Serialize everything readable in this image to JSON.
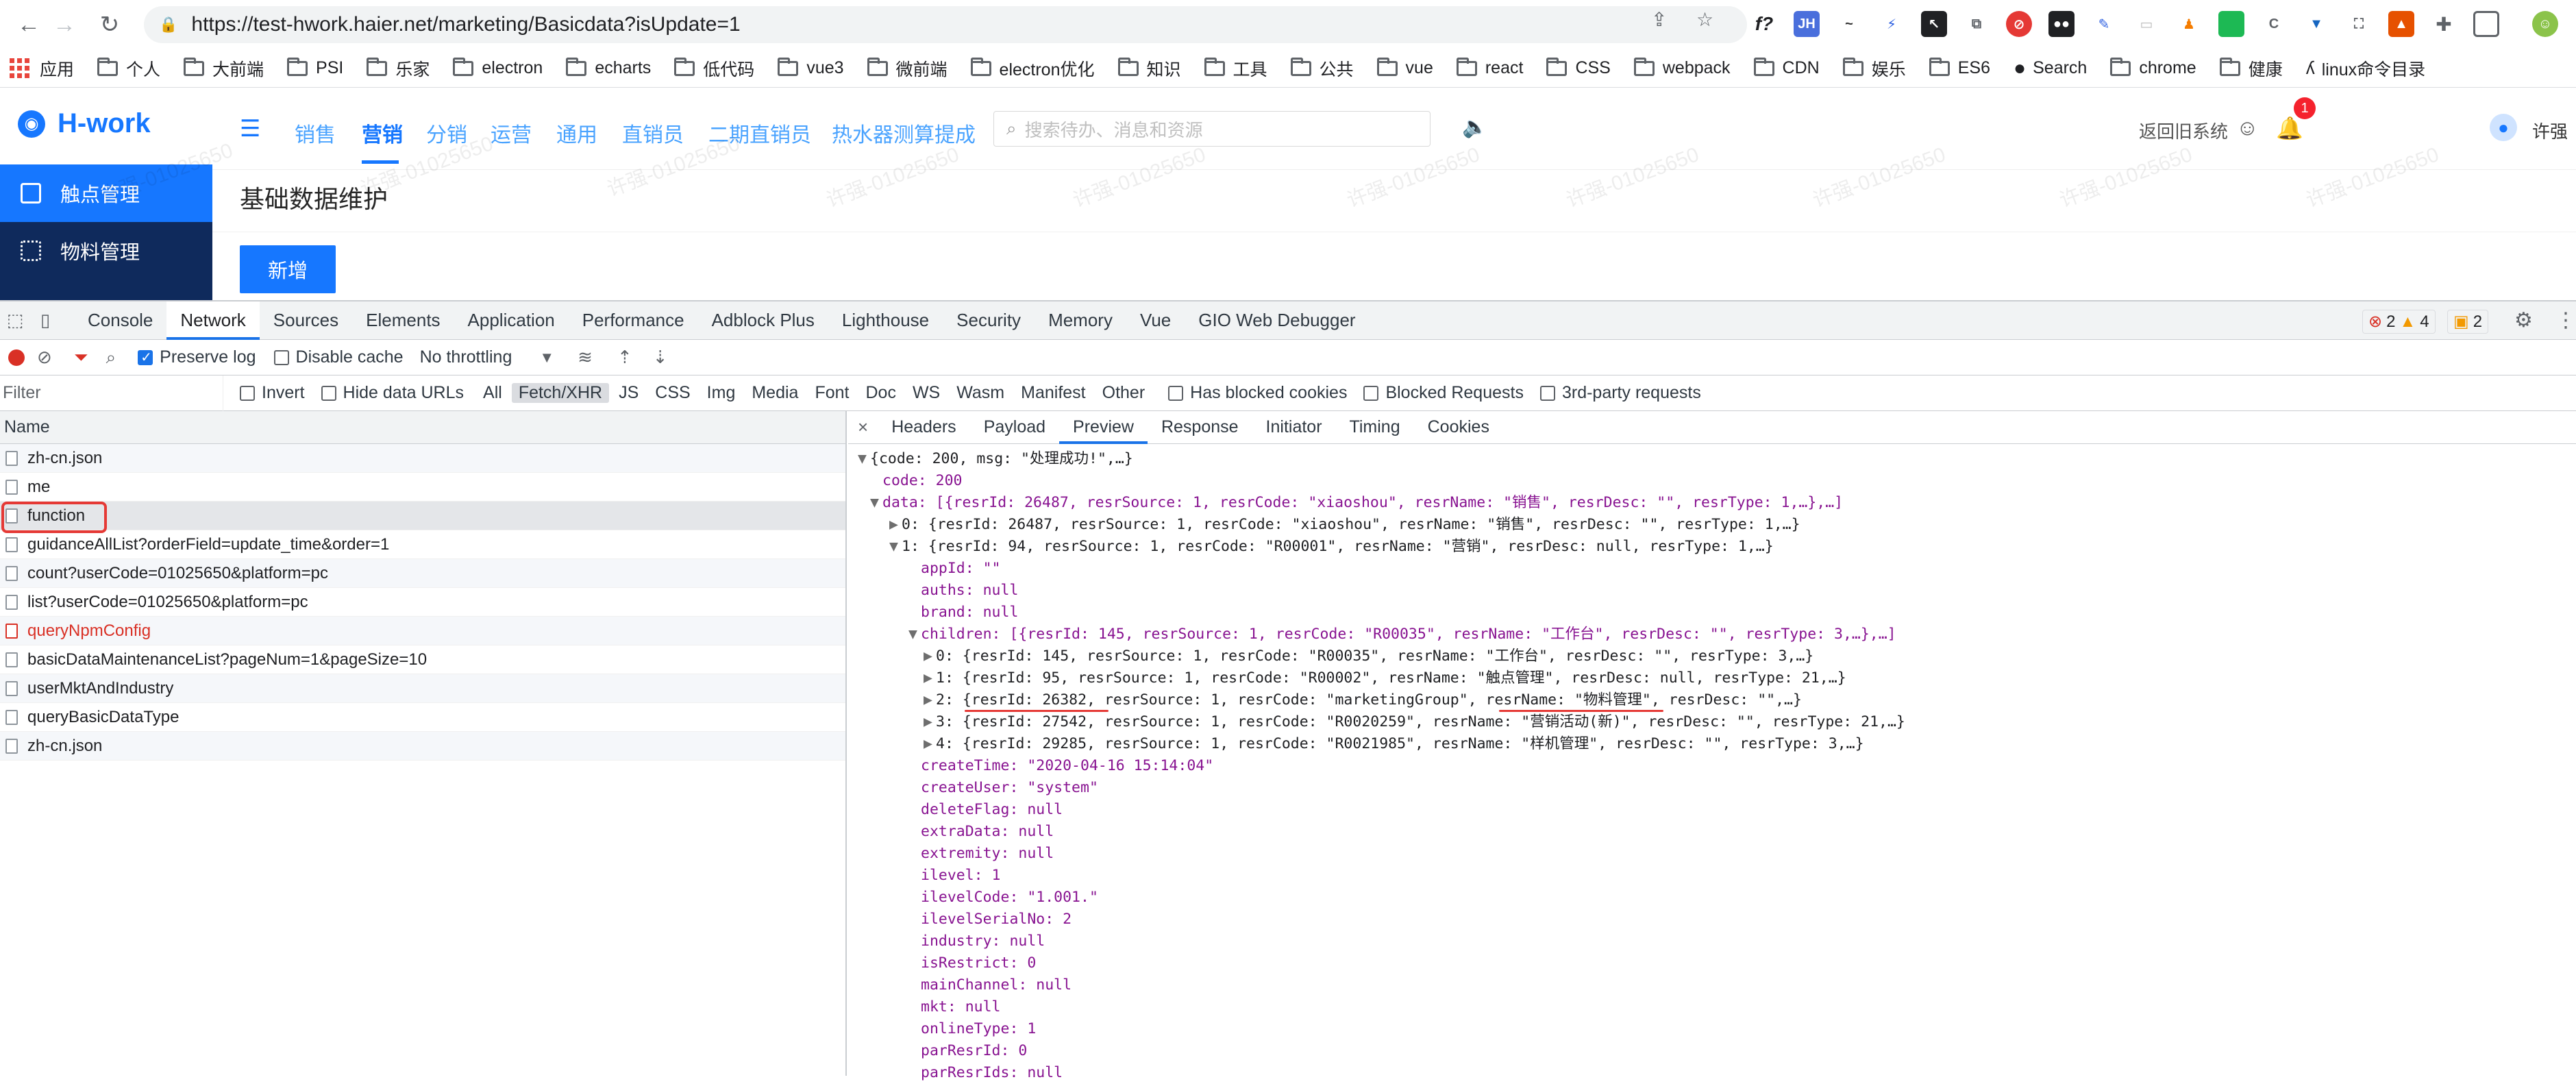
{
  "browser": {
    "url": "https://test-hwork.haier.net/marketing/Basicdata?isUpdate=1",
    "bookmarks": [
      "应用",
      "个人",
      "大前端",
      "PSI",
      "乐家",
      "electron",
      "echarts",
      "低代码",
      "vue3",
      "微前端",
      "electron优化",
      "知识",
      "工具",
      "公共",
      "vue",
      "react",
      "CSS",
      "webpack",
      "CDN",
      "娱乐",
      "ES6",
      "Search",
      "chrome",
      "健康",
      "linux命令目录"
    ]
  },
  "app": {
    "logo": "H-work",
    "nav": [
      "销售",
      "营销",
      "分销",
      "运营",
      "通用",
      "直销员",
      "二期直销员",
      "热水器测算提成"
    ],
    "active_nav": "营销",
    "search_placeholder": "搜索待办、消息和资源",
    "return_old": "返回旧系统",
    "notification_count": "1",
    "user": "许强",
    "sidebar": [
      "触点管理",
      "物料管理"
    ],
    "page_title": "基础数据维护",
    "new_button": "新增",
    "watermark": "许强-01025650"
  },
  "devtools": {
    "tabs": [
      "Console",
      "Network",
      "Sources",
      "Elements",
      "Application",
      "Performance",
      "Adblock Plus",
      "Lighthouse",
      "Security",
      "Memory",
      "Vue",
      "GIO Web Debugger"
    ],
    "active_tab": "Network",
    "errors": "2",
    "warnings": "4",
    "issues": "2",
    "toolbar": {
      "preserve_log": "Preserve log",
      "disable_cache": "Disable cache",
      "throttling": "No throttling"
    },
    "filter": {
      "placeholder": "Filter",
      "invert": "Invert",
      "hide_data_urls": "Hide data URLs",
      "types": [
        "All",
        "Fetch/XHR",
        "JS",
        "CSS",
        "Img",
        "Media",
        "Font",
        "Doc",
        "WS",
        "Wasm",
        "Manifest",
        "Other"
      ],
      "selected_type": "Fetch/XHR",
      "has_blocked": "Has blocked cookies",
      "blocked_requests": "Blocked Requests",
      "third_party": "3rd-party requests"
    },
    "requests_header": "Name",
    "requests": [
      "zh-cn.json",
      "me",
      "function",
      "guidanceAllList?orderField=update_time&order=1",
      "count?userCode=01025650&platform=pc",
      "list?userCode=01025650&platform=pc",
      "queryNpmConfig",
      "basicDataMaintenanceList?pageNum=1&pageSize=10",
      "userMktAndIndustry",
      "queryBasicDataType",
      "zh-cn.json"
    ],
    "detail_tabs": [
      "Headers",
      "Payload",
      "Preview",
      "Response",
      "Initiator",
      "Timing",
      "Cookies"
    ],
    "active_detail_tab": "Preview",
    "json_lines": [
      {
        "t": "▼",
        "text": "{code: 200, msg: \"处理成功!\",…}"
      },
      {
        "t": "",
        "text": "code: 200"
      },
      {
        "t": "▼",
        "text": "data: [{resrId: 26487, resrSource: 1, resrCode: \"xiaoshou\", resrName: \"销售\", resrDesc: \"\", resrType: 1,…},…]"
      },
      {
        "t": "▶",
        "text": "0: {resrId: 26487, resrSource: 1, resrCode: \"xiaoshou\", resrName: \"销售\", resrDesc: \"\", resrType: 1,…}"
      },
      {
        "t": "▼",
        "text": "1: {resrId: 94, resrSource: 1, resrCode: \"R00001\", resrName: \"营销\", resrDesc: null, resrType: 1,…}"
      },
      {
        "t": "",
        "text": "appId: \"\""
      },
      {
        "t": "",
        "text": "auths: null"
      },
      {
        "t": "",
        "text": "brand: null"
      },
      {
        "t": "▼",
        "text": "children: [{resrId: 145, resrSource: 1, resrCode: \"R00035\", resrName: \"工作台\", resrDesc: \"\", resrType: 3,…},…]"
      },
      {
        "t": "▶",
        "text": "0: {resrId: 145, resrSource: 1, resrCode: \"R00035\", resrName: \"工作台\", resrDesc: \"\", resrType: 3,…}"
      },
      {
        "t": "▶",
        "text": "1: {resrId: 95, resrSource: 1, resrCode: \"R00002\", resrName: \"触点管理\", resrDesc: null, resrType: 21,…}"
      },
      {
        "t": "▶",
        "text": "2: {resrId: 26382, resrSource: 1, resrCode: \"marketingGroup\", resrName: \"物料管理\", resrDesc: \"\",…}"
      },
      {
        "t": "▶",
        "text": "3: {resrId: 27542, resrSource: 1, resrCode: \"R0020259\", resrName: \"营销活动(新)\", resrDesc: \"\", resrType: 21,…}"
      },
      {
        "t": "▶",
        "text": "4: {resrId: 29285, resrSource: 1, resrCode: \"R0021985\", resrName: \"样机管理\", resrDesc: \"\", resrType: 3,…}"
      },
      {
        "t": "",
        "text": "createTime: \"2020-04-16 15:14:04\""
      },
      {
        "t": "",
        "text": "createUser: \"system\""
      },
      {
        "t": "",
        "text": "deleteFlag: null"
      },
      {
        "t": "",
        "text": "extraData: null"
      },
      {
        "t": "",
        "text": "extremity: null"
      },
      {
        "t": "",
        "text": "ilevel: 1"
      },
      {
        "t": "",
        "text": "ilevelCode: \"1.001.\""
      },
      {
        "t": "",
        "text": "ilevelSerialNo: 2"
      },
      {
        "t": "",
        "text": "industry: null"
      },
      {
        "t": "",
        "text": "isRestrict: 0"
      },
      {
        "t": "",
        "text": "mainChannel: null"
      },
      {
        "t": "",
        "text": "mkt: null"
      },
      {
        "t": "",
        "text": "onlineType: 1"
      },
      {
        "t": "",
        "text": "parResrId: 0"
      },
      {
        "t": "",
        "text": "parResrIds: null"
      }
    ],
    "colors": {
      "accent": "#1a73e8",
      "error": "#d93025",
      "highlight": "#e53935"
    }
  }
}
